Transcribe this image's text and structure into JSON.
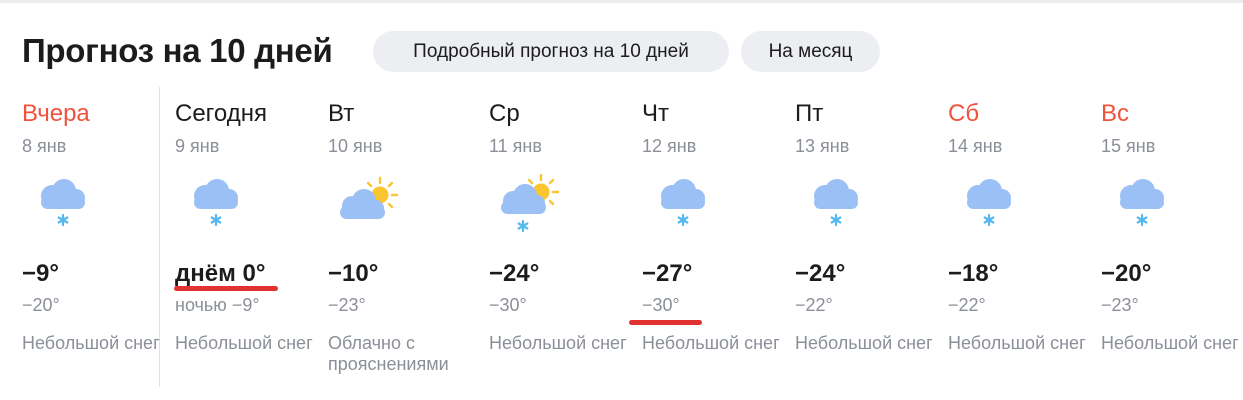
{
  "header": {
    "title": "Прогноз на 10 дней",
    "buttons": [
      {
        "label": "Подробный прогноз на 10 дней"
      },
      {
        "label": "На месяц"
      }
    ]
  },
  "days": [
    {
      "name": "Вчера",
      "date": "8 янв",
      "t_max": "−9°",
      "t_min": "−20°",
      "condition": "Небольшой снег",
      "icon": "cloud-snow-icon",
      "weekend": true
    },
    {
      "name": "Сегодня",
      "date": "9 янв",
      "t_max": "днём 0°",
      "t_min": "ночью −9°",
      "condition": "Небольшой снег",
      "icon": "cloud-snow-icon",
      "weekend": false
    },
    {
      "name": "Вт",
      "date": "10 янв",
      "t_max": "−10°",
      "t_min": "−23°",
      "condition": "Облачно с прояснениями",
      "icon": "partly-cloudy-icon",
      "weekend": false
    },
    {
      "name": "Ср",
      "date": "11 янв",
      "t_max": "−24°",
      "t_min": "−30°",
      "condition": "Небольшой снег",
      "icon": "sun-cloud-snow-icon",
      "weekend": false
    },
    {
      "name": "Чт",
      "date": "12 янв",
      "t_max": "−27°",
      "t_min": "−30°",
      "condition": "Небольшой снег",
      "icon": "cloud-snow-icon",
      "weekend": false
    },
    {
      "name": "Пт",
      "date": "13 янв",
      "t_max": "−24°",
      "t_min": "−22°",
      "condition": "Небольшой снег",
      "icon": "cloud-snow-icon",
      "weekend": false
    },
    {
      "name": "Сб",
      "date": "14 янв",
      "t_max": "−18°",
      "t_min": "−22°",
      "condition": "Небольшой снег",
      "icon": "cloud-snow-icon",
      "weekend": true
    },
    {
      "name": "Вс",
      "date": "15 янв",
      "t_max": "−20°",
      "t_min": "−23°",
      "condition": "Небольшой снег",
      "icon": "cloud-snow-icon",
      "weekend": true
    }
  ],
  "colors": {
    "weekend_red": "#f0533c",
    "cloud_blue": "#9bc0f6",
    "snowflake": "#54b8f0",
    "sun": "#fbc531",
    "underline_red": "#e23131"
  }
}
